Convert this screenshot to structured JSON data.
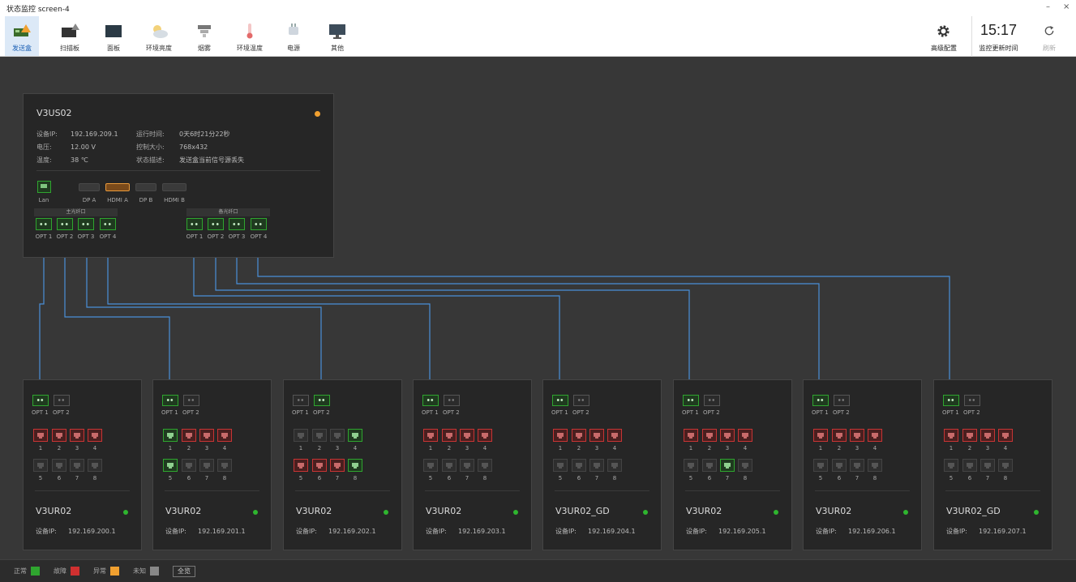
{
  "window": {
    "title": "状态监控 screen-4",
    "minimize": "–",
    "close": "×"
  },
  "toolbar": {
    "items": [
      {
        "label": "发送盒",
        "icon": "sender-box-icon",
        "active": true
      },
      {
        "label": "扫描板",
        "icon": "scan-board-icon"
      },
      {
        "label": "面板",
        "icon": "panel-icon"
      },
      {
        "label": "环境亮度",
        "icon": "weather-icon"
      },
      {
        "label": "烟雾",
        "icon": "smoke-detector-icon"
      },
      {
        "label": "环境温度",
        "icon": "thermometer-icon"
      },
      {
        "label": "电源",
        "icon": "power-plug-icon"
      },
      {
        "label": "其他",
        "icon": "monitor-icon"
      }
    ],
    "advanced": "高级配置",
    "time": "15:17",
    "time_label": "监控更新时间",
    "refresh": "刷新"
  },
  "sender": {
    "name": "V3US02",
    "status_color": "#f0a030",
    "ip_label": "设备IP:",
    "ip": "192.169.209.1",
    "voltage_label": "电压:",
    "voltage": "12.00 V",
    "temp_label": "温度:",
    "temp": "38 ℃",
    "uptime_label": "运行时间:",
    "uptime": "0天6时21分22秒",
    "ctrl_label": "控制大小:",
    "ctrl": "768x432",
    "desc_label": "状态描述:",
    "desc": "发送盒当前信号源丢失",
    "lan": "Lan",
    "video_ports": [
      "DP A",
      "HDMI A",
      "DP B",
      "HDMI B"
    ],
    "main_group": "主光纤口",
    "backup_group": "备光纤口",
    "opt_labels": [
      "OPT 1",
      "OPT 2",
      "OPT 3",
      "OPT 4"
    ]
  },
  "receivers": [
    {
      "name": "V3UR02",
      "ip": "192.169.200.1",
      "opt_on": 1,
      "ports": [
        "red",
        "red",
        "red",
        "red",
        "gray",
        "gray",
        "gray",
        "gray"
      ]
    },
    {
      "name": "V3UR02",
      "ip": "192.169.201.1",
      "opt_on": 1,
      "ports": [
        "green",
        "red",
        "red",
        "red",
        "green",
        "gray",
        "gray",
        "gray"
      ]
    },
    {
      "name": "V3UR02",
      "ip": "192.169.202.1",
      "opt_on": 2,
      "ports": [
        "gray",
        "gray",
        "gray",
        "green",
        "red",
        "red",
        "red",
        "green"
      ]
    },
    {
      "name": "V3UR02",
      "ip": "192.169.203.1",
      "opt_on": 1,
      "ports": [
        "red",
        "red",
        "red",
        "red",
        "gray",
        "gray",
        "gray",
        "gray"
      ]
    },
    {
      "name": "V3UR02_GD",
      "ip": "192.169.204.1",
      "opt_on": 1,
      "ports": [
        "red",
        "red",
        "red",
        "red",
        "gray",
        "gray",
        "gray",
        "gray"
      ]
    },
    {
      "name": "V3UR02",
      "ip": "192.169.205.1",
      "opt_on": 1,
      "ports": [
        "red",
        "red",
        "red",
        "red",
        "gray",
        "gray",
        "green",
        "gray"
      ]
    },
    {
      "name": "V3UR02",
      "ip": "192.169.206.1",
      "opt_on": 1,
      "ports": [
        "red",
        "red",
        "red",
        "red",
        "gray",
        "gray",
        "gray",
        "gray"
      ]
    },
    {
      "name": "V3UR02_GD",
      "ip": "192.169.207.1",
      "opt_on": 1,
      "ports": [
        "red",
        "red",
        "red",
        "red",
        "gray",
        "gray",
        "gray",
        "gray"
      ]
    }
  ],
  "receiver_labels": {
    "ip_label": "设备IP:",
    "opt1": "OPT 1",
    "opt2": "OPT 2",
    "nums": [
      "1",
      "2",
      "3",
      "4",
      "5",
      "6",
      "7",
      "8"
    ]
  },
  "legend": [
    {
      "label": "正常",
      "color": "#2fa52f"
    },
    {
      "label": "故障",
      "color": "#d03030"
    },
    {
      "label": "异常",
      "color": "#f0a030"
    },
    {
      "label": "未知",
      "color": "#888888"
    }
  ],
  "all_button": "全览",
  "colors": {
    "wire": "#4a8fd8",
    "ok": "#2fa52f",
    "fault": "#d03030",
    "warn": "#f0a030"
  }
}
